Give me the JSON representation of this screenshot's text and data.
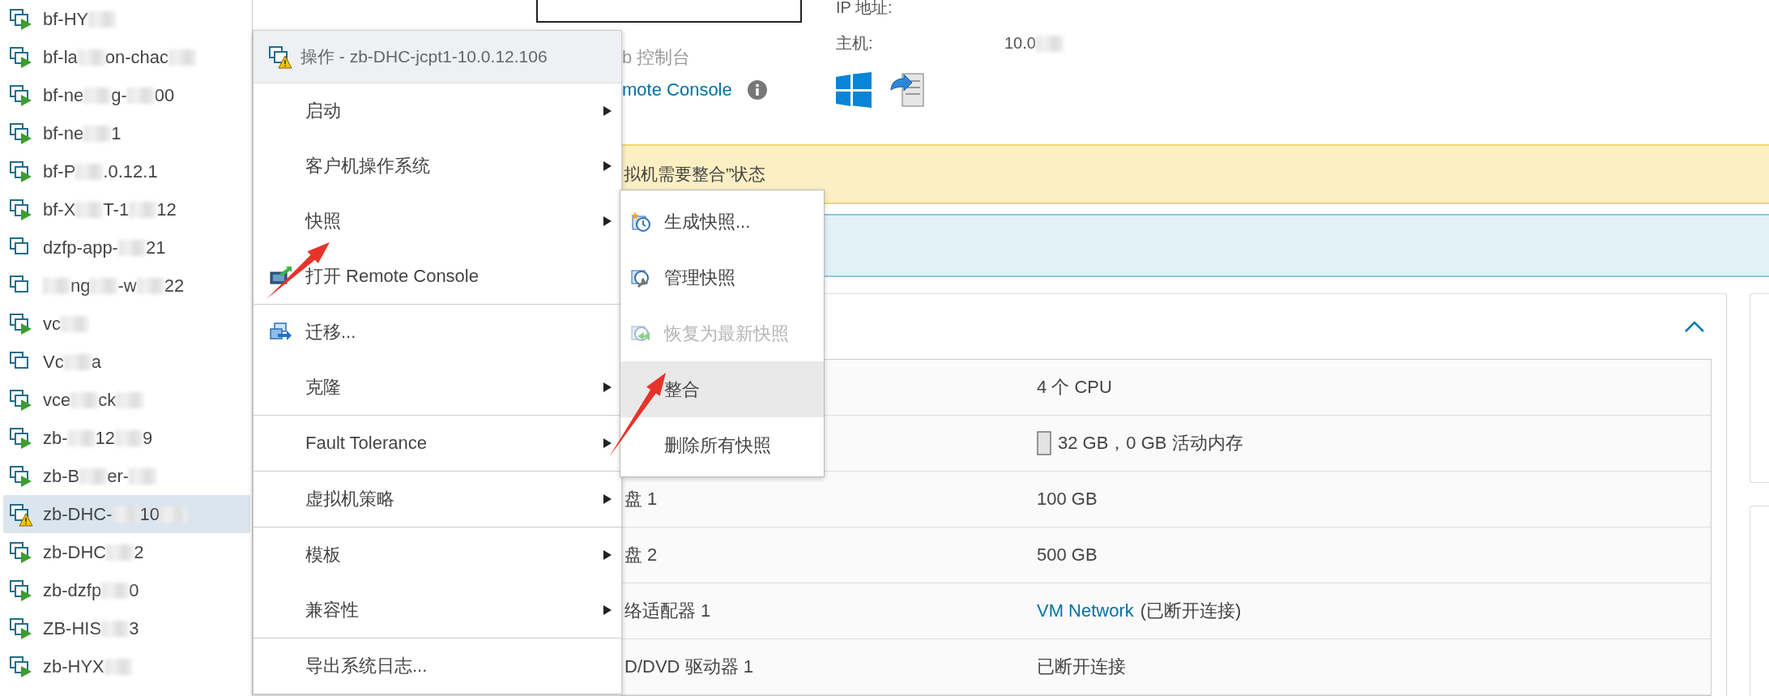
{
  "tree": {
    "items": [
      {
        "kind": "running",
        "selected": false,
        "segments": [
          {
            "kind": "text",
            "text": "bf-HY"
          },
          {
            "kind": "blur"
          }
        ]
      },
      {
        "kind": "running",
        "selected": false,
        "segments": [
          {
            "kind": "text",
            "text": "bf-la"
          },
          {
            "kind": "blur"
          },
          {
            "kind": "text",
            "text": "on-chac"
          },
          {
            "kind": "blur"
          }
        ]
      },
      {
        "kind": "running",
        "selected": false,
        "segments": [
          {
            "kind": "text",
            "text": "bf-ne"
          },
          {
            "kind": "blur"
          },
          {
            "kind": "text",
            "text": "g-"
          },
          {
            "kind": "blur"
          },
          {
            "kind": "text",
            "text": "00"
          }
        ]
      },
      {
        "kind": "running",
        "selected": false,
        "segments": [
          {
            "kind": "text",
            "text": "bf-ne"
          },
          {
            "kind": "blur"
          },
          {
            "kind": "text",
            "text": "1"
          }
        ]
      },
      {
        "kind": "running",
        "selected": false,
        "segments": [
          {
            "kind": "text",
            "text": "bf-P"
          },
          {
            "kind": "blur"
          },
          {
            "kind": "text",
            "text": ".0.12.1"
          }
        ]
      },
      {
        "kind": "running",
        "selected": false,
        "segments": [
          {
            "kind": "text",
            "text": "bf-X"
          },
          {
            "kind": "blur"
          },
          {
            "kind": "text",
            "text": "T-1"
          },
          {
            "kind": "blur"
          },
          {
            "kind": "text",
            "text": "12"
          }
        ]
      },
      {
        "kind": "stopped",
        "selected": false,
        "segments": [
          {
            "kind": "text",
            "text": "dzfp-app-"
          },
          {
            "kind": "blur"
          },
          {
            "kind": "text",
            "text": "21"
          }
        ]
      },
      {
        "kind": "stopped",
        "selected": false,
        "segments": [
          {
            "kind": "blur"
          },
          {
            "kind": "text",
            "text": "ng"
          },
          {
            "kind": "blur"
          },
          {
            "kind": "text",
            "text": "-w"
          },
          {
            "kind": "blur"
          },
          {
            "kind": "text",
            "text": "22"
          }
        ]
      },
      {
        "kind": "running",
        "selected": false,
        "segments": [
          {
            "kind": "text",
            "text": "vc"
          },
          {
            "kind": "blur"
          }
        ]
      },
      {
        "kind": "stopped",
        "selected": false,
        "segments": [
          {
            "kind": "text",
            "text": "Vc"
          },
          {
            "kind": "blur"
          },
          {
            "kind": "text",
            "text": "a"
          }
        ]
      },
      {
        "kind": "running",
        "selected": false,
        "segments": [
          {
            "kind": "text",
            "text": "vce"
          },
          {
            "kind": "blur"
          },
          {
            "kind": "text",
            "text": "ck"
          },
          {
            "kind": "blur"
          }
        ]
      },
      {
        "kind": "running",
        "selected": false,
        "segments": [
          {
            "kind": "text",
            "text": "zb-"
          },
          {
            "kind": "blur"
          },
          {
            "kind": "text",
            "text": "12"
          },
          {
            "kind": "blur"
          },
          {
            "kind": "text",
            "text": "9"
          }
        ]
      },
      {
        "kind": "running",
        "selected": false,
        "segments": [
          {
            "kind": "text",
            "text": "zb-B"
          },
          {
            "kind": "blur"
          },
          {
            "kind": "text",
            "text": "er-"
          },
          {
            "kind": "blur"
          }
        ]
      },
      {
        "kind": "warning",
        "selected": true,
        "segments": [
          {
            "kind": "text",
            "text": "zb-DHC-"
          },
          {
            "kind": "blur"
          },
          {
            "kind": "text",
            "text": "10"
          },
          {
            "kind": "blur"
          }
        ]
      },
      {
        "kind": "running",
        "selected": false,
        "segments": [
          {
            "kind": "text",
            "text": "zb-DHC"
          },
          {
            "kind": "blur"
          },
          {
            "kind": "text",
            "text": "2"
          }
        ]
      },
      {
        "kind": "running",
        "selected": false,
        "segments": [
          {
            "kind": "text",
            "text": "zb-dzfp"
          },
          {
            "kind": "blur"
          },
          {
            "kind": "text",
            "text": "0"
          }
        ]
      },
      {
        "kind": "running",
        "selected": false,
        "segments": [
          {
            "kind": "text",
            "text": "ZB-HIS"
          },
          {
            "kind": "blur"
          },
          {
            "kind": "text",
            "text": "3"
          }
        ]
      },
      {
        "kind": "running",
        "selected": false,
        "segments": [
          {
            "kind": "text",
            "text": "zb-HYX"
          },
          {
            "kind": "blur"
          }
        ]
      }
    ]
  },
  "summary": {
    "console_label": "b 控制台",
    "console_link": "mote Console",
    "ip_label": "IP 地址:",
    "host_label": "主机:",
    "host_value": "10.0"
  },
  "warning_banner": {
    "text": "拟机需要整合”状态"
  },
  "hardware": {
    "rows": [
      {
        "kind": "plain",
        "value": "4 个 CPU"
      },
      {
        "kind": "memory",
        "value": "32 GB，0 GB 活动内存"
      },
      {
        "kind": "plain",
        "label": "盘 1",
        "value": "100 GB"
      },
      {
        "kind": "plain",
        "label": "盘 2",
        "value": "500 GB"
      },
      {
        "kind": "link",
        "label": "络适配器 1",
        "link": "VM Network",
        "value": "(已断开连接)"
      },
      {
        "kind": "plain",
        "label": "D/DVD 驱动器 1",
        "value": "已断开连接"
      }
    ]
  },
  "menu": {
    "title": "操作 - zb-DHC-jcpt1-10.0.12.106",
    "groups": [
      [
        {
          "kind": "plain",
          "label": "启动",
          "submenu": true
        },
        {
          "kind": "plain",
          "label": "客户机操作系统",
          "submenu": true
        },
        {
          "kind": "plain",
          "label": "快照",
          "submenu": true
        },
        {
          "kind": "console",
          "label": "打开 Remote Console",
          "submenu": false
        }
      ],
      [
        {
          "kind": "migrate",
          "label": "迁移...",
          "submenu": false
        },
        {
          "kind": "plain",
          "label": "克隆",
          "submenu": true
        }
      ],
      [
        {
          "kind": "plain",
          "label": "Fault Tolerance",
          "submenu": true
        }
      ],
      [
        {
          "kind": "plain",
          "label": "虚拟机策略",
          "submenu": true
        }
      ],
      [
        {
          "kind": "plain",
          "label": "模板",
          "submenu": true
        },
        {
          "kind": "plain",
          "label": "兼容性",
          "submenu": true
        }
      ],
      [
        {
          "kind": "plain",
          "label": "导出系统日志...",
          "submenu": false
        }
      ]
    ]
  },
  "submenu": {
    "items": [
      {
        "kind": "take",
        "label": "生成快照...",
        "disabled": false,
        "selected": false
      },
      {
        "kind": "manage",
        "label": "管理快照",
        "disabled": false,
        "selected": false
      },
      {
        "kind": "revert",
        "label": "恢复为最新快照",
        "disabled": true,
        "selected": false
      },
      {
        "kind": "plain",
        "label": "整合",
        "disabled": false,
        "selected": true
      },
      {
        "kind": "plain",
        "label": "删除所有快照",
        "disabled": false,
        "selected": false
      }
    ]
  }
}
